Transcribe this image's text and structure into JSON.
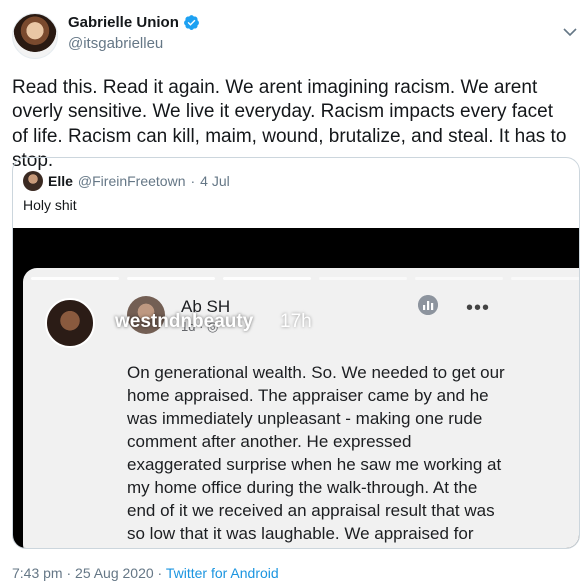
{
  "author": {
    "display_name": "Gabrielle Union",
    "handle": "@itsgabrielleu",
    "verified": true
  },
  "tweet": {
    "text": "Read this. Read it again. We arent imagining racism. We arent overly sensitive. We live it everyday. Racism impacts every facet of life. Racism can kill, maim, wound, brutalize, and steal. It has to stop."
  },
  "quoted": {
    "name": "Elle",
    "handle": "@FireinFreetown",
    "separator": "·",
    "date": "4 Jul",
    "text": "Holy shit",
    "media": {
      "story_user": "westndnbeauty",
      "story_time": "17h",
      "post_author": "Ab SH",
      "post_meta": "1d · ◎",
      "post_more": "•••",
      "post_text": "On generational wealth. So. We needed to get our home appraised. The appraiser came by and he was immediately unpleasant - making one rude comment after another. He expressed exaggerated surprise  when he saw me working at my home office during the walk-through. At the end of it we received an appraisal result that was so low that it was laughable. We appraised for lower than neighboring home"
    }
  },
  "footer": {
    "timestamp": "7:43 pm · 25 Aug 2020 · ",
    "source": "Twitter for Android"
  },
  "colors": {
    "link": "#1b95e0",
    "muted": "#657786",
    "verified": "#1da1f2"
  },
  "icons": [
    "verified-badge-icon",
    "caret-down-icon",
    "analytics-icon",
    "more-icon",
    "globe-icon"
  ]
}
